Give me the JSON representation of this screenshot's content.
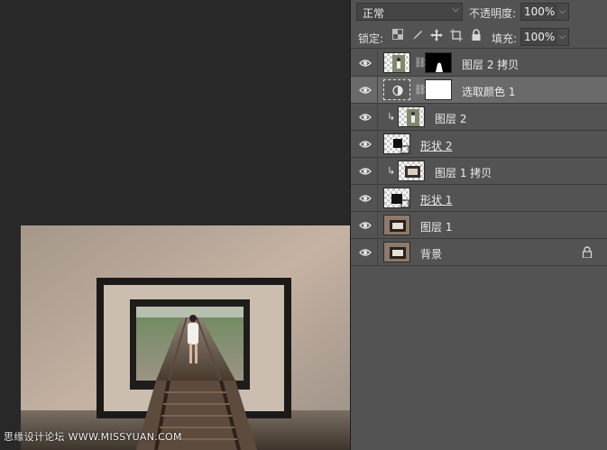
{
  "canvas": {
    "watermark": "思缘设计论坛 WWW.MISSYUAN.COM"
  },
  "layers_panel": {
    "blend_mode": "正常",
    "opacity_label": "不透明度:",
    "opacity_value": "100%",
    "lock_label": "锁定:",
    "lock_icons": [
      "lock-transparent-pixels-icon",
      "lock-image-pixels-icon",
      "lock-position-icon",
      "lock-artboard-icon",
      "lock-all-icon"
    ],
    "fill_label": "填充:",
    "fill_value": "100%",
    "layers": [
      {
        "name": "图层 2 拷贝",
        "visible": true,
        "selected": false,
        "clipped": false,
        "thumb": "photo-girl",
        "mask": "black-mask-with-figure",
        "underline": false,
        "locked": false
      },
      {
        "name": "选取颜色 1",
        "visible": true,
        "selected": true,
        "clipped": false,
        "thumb": "adjustment-selective-color",
        "mask": "white-mask",
        "underline": false,
        "locked": false
      },
      {
        "name": "图层 2",
        "visible": true,
        "selected": false,
        "clipped": true,
        "thumb": "photo-girl",
        "mask": "",
        "underline": false,
        "locked": false
      },
      {
        "name": "形状 2",
        "visible": true,
        "selected": false,
        "clipped": false,
        "thumb": "shape",
        "mask": "",
        "underline": true,
        "locked": false
      },
      {
        "name": "图层 1 拷贝",
        "visible": true,
        "selected": false,
        "clipped": true,
        "thumb": "photo-frame",
        "mask": "",
        "underline": false,
        "locked": false
      },
      {
        "name": "形状 1",
        "visible": true,
        "selected": false,
        "clipped": false,
        "thumb": "shape",
        "mask": "",
        "underline": true,
        "locked": false
      },
      {
        "name": "图层 1",
        "visible": true,
        "selected": false,
        "clipped": false,
        "thumb": "photo-frame-wall",
        "mask": "",
        "underline": false,
        "locked": false
      },
      {
        "name": "背景",
        "visible": true,
        "selected": false,
        "clipped": false,
        "thumb": "photo-frame-wall",
        "mask": "",
        "underline": false,
        "locked": true
      }
    ]
  },
  "colors": {
    "workspace": "#282828",
    "panel": "#535353",
    "selected_row": "#6a6a6a"
  }
}
